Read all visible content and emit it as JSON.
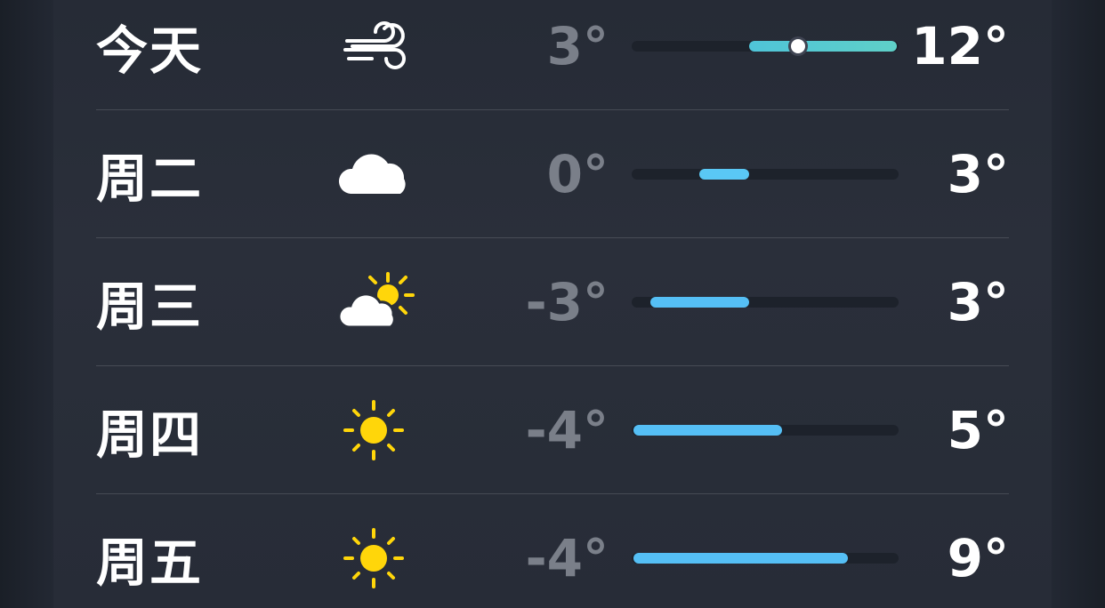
{
  "forecast": {
    "scale": {
      "min": -4,
      "max": 12
    },
    "current_temp": 6,
    "days": [
      {
        "day": "今天",
        "icon": "wind-icon",
        "low": "3°",
        "high": "12°",
        "low_value": 3,
        "high_value": 12,
        "show_current": true,
        "bar_color": "#5fd0c8"
      },
      {
        "day": "周二",
        "icon": "cloud-icon",
        "low": "0°",
        "high": "3°",
        "low_value": 0,
        "high_value": 3,
        "show_current": false,
        "bar_color": "#5ac8f5"
      },
      {
        "day": "周三",
        "icon": "partly-sunny-icon",
        "low": "-3°",
        "high": "3°",
        "low_value": -3,
        "high_value": 3,
        "show_current": false,
        "bar_color": "#55bff5"
      },
      {
        "day": "周四",
        "icon": "sun-icon",
        "low": "-4°",
        "high": "5°",
        "low_value": -4,
        "high_value": 5,
        "show_current": false,
        "bar_color": "#55bff5"
      },
      {
        "day": "周五",
        "icon": "sun-icon",
        "low": "-4°",
        "high": "9°",
        "low_value": -4,
        "high_value": 9,
        "show_current": false,
        "bar_color": "#55bff5"
      }
    ]
  },
  "colors": {
    "sun": "#ffd60a",
    "cloud": "#ffffff",
    "wind": "#ffffff"
  }
}
